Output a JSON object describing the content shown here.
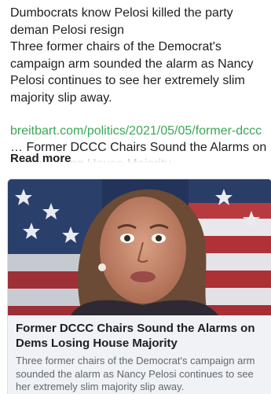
{
  "post": {
    "text_lines": [
      "Dumbocrats know Pelosi killed the party deman Pelosi resign",
      "Three former chairs of the Democrat's campaign arm sounded the alarm as Nancy Pelosi continues to see her extremely slim majority slip away."
    ],
    "link_url": "breitbart.com/politics/2021/05/05/former-dccc",
    "link_snippet": "… Former DCCC Chairs Sound the Alarms on Dems Losing House Majority",
    "read_more": "Read more"
  },
  "card": {
    "title": "Former DCCC Chairs Sound the Alarms on Dems Losing House Majority",
    "description": "Three former chairs of the Democrat's campaign arm sounded the alarm as Nancy Pelosi continues to see her extremely slim majority slip away."
  },
  "colors": {
    "link": "#3aa757",
    "card_bg": "#f0f2f5",
    "muted_text": "#606770"
  }
}
